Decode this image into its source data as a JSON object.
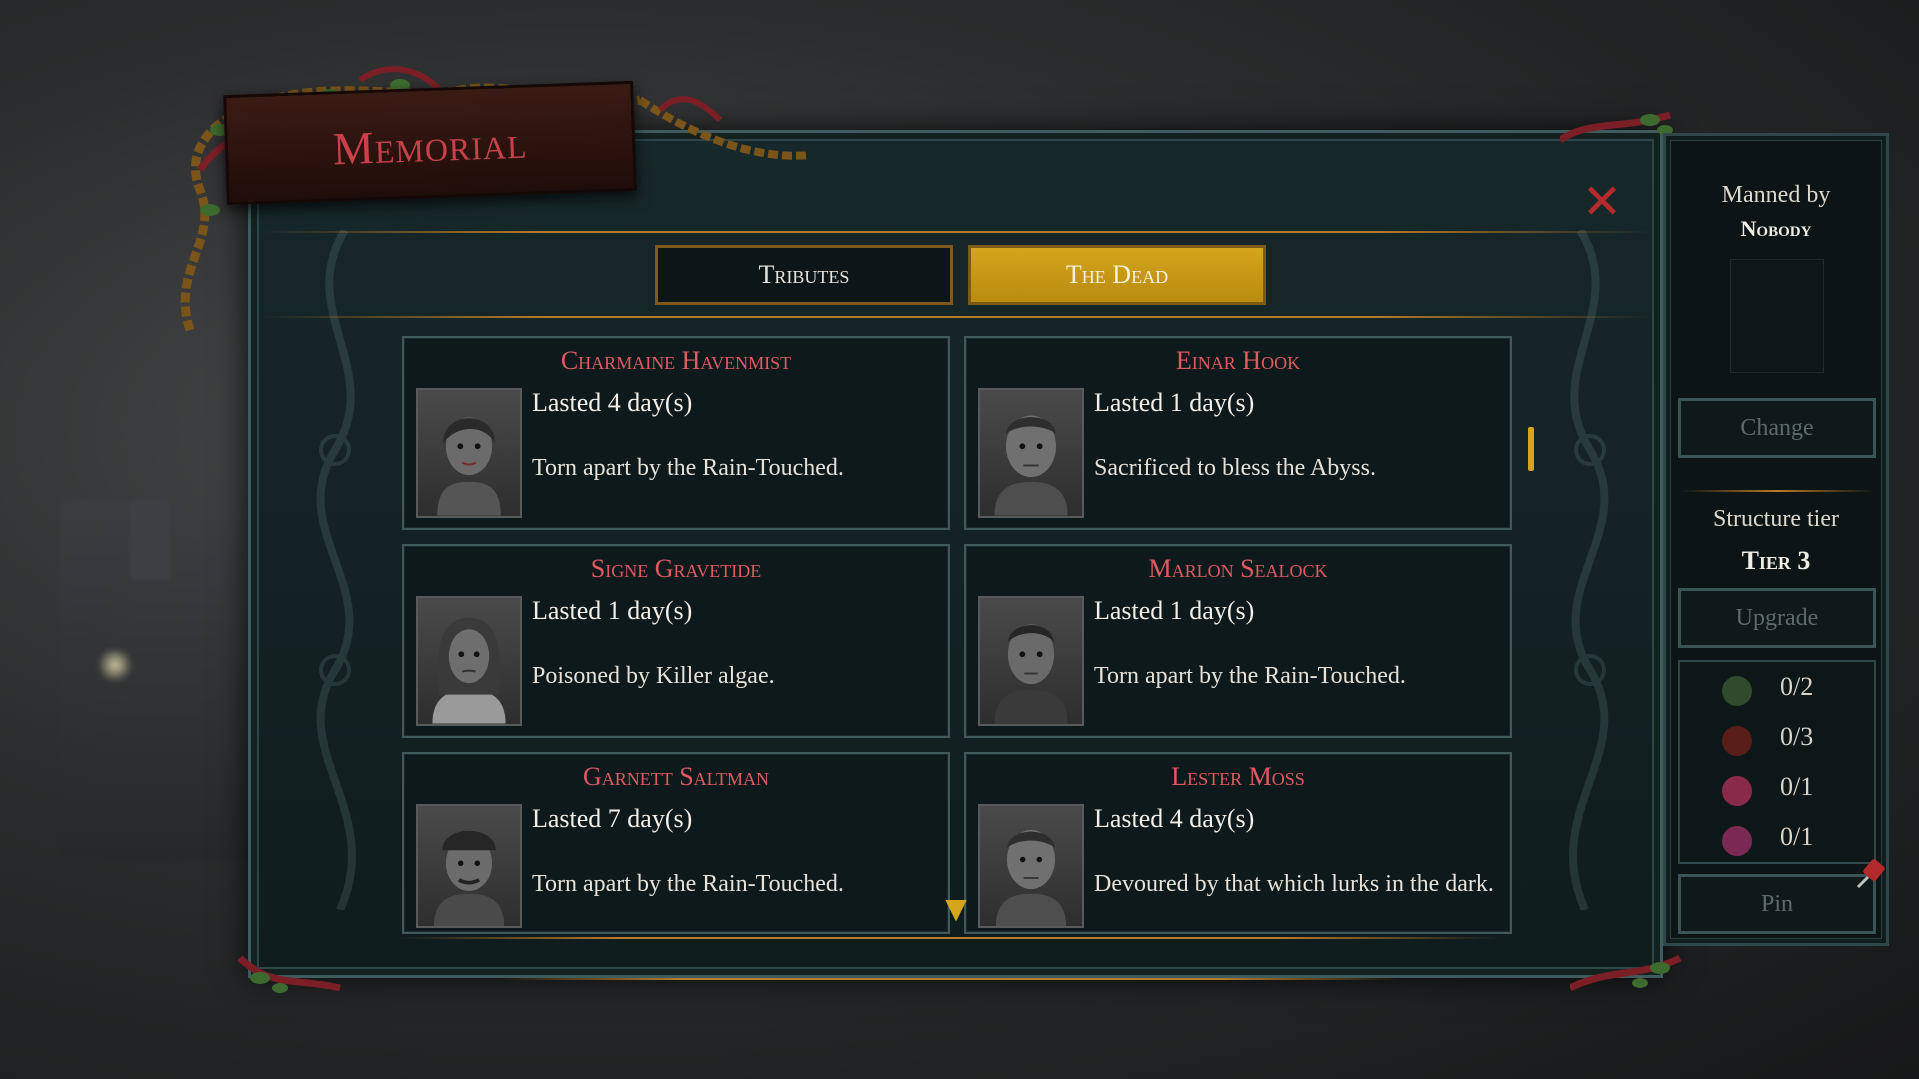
{
  "window": {
    "title": "Memorial"
  },
  "tabs": [
    {
      "label": "Tributes",
      "active": false
    },
    {
      "label": "The Dead",
      "active": true
    }
  ],
  "dead": [
    {
      "name": "Charmaine Havenmist",
      "lasted": "Lasted 4 day(s)",
      "cause": "Torn apart by the Rain-Touched."
    },
    {
      "name": "Einar Hook",
      "lasted": "Lasted 1 day(s)",
      "cause": "Sacrificed to bless the Abyss."
    },
    {
      "name": "Signe Gravetide",
      "lasted": "Lasted 1 day(s)",
      "cause": "Poisoned by Killer algae."
    },
    {
      "name": "Marlon Sealock",
      "lasted": "Lasted 1 day(s)",
      "cause": "Torn apart by the Rain-Touched."
    },
    {
      "name": "Garnett Saltman",
      "lasted": "Lasted 7 day(s)",
      "cause": "Torn apart by the Rain-Touched."
    },
    {
      "name": "Lester Moss",
      "lasted": "Lasted 4 day(s)",
      "cause": "Devoured by that which lurks in the dark."
    }
  ],
  "side": {
    "manned_label": "Manned by",
    "manned_name": "Nobody",
    "change_label": "Change",
    "tier_label": "Structure tier",
    "tier_value": "Tier 3",
    "upgrade_label": "Upgrade",
    "pin_label": "Pin",
    "resources": [
      {
        "icon": "seaweed-icon",
        "value": "0/2",
        "color": "#2f4a2c"
      },
      {
        "icon": "coral-icon",
        "value": "0/3",
        "color": "#5a1e18"
      },
      {
        "icon": "heart-icon",
        "value": "0/1",
        "color": "#8a2a4a"
      },
      {
        "icon": "brain-icon",
        "value": "0/1",
        "color": "#7a2a52"
      }
    ]
  },
  "colors": {
    "accent_gold": "#d5a51b",
    "name_red": "#e05a62",
    "title_red": "#c8404a",
    "panel_bg": "#0f1c1e"
  }
}
